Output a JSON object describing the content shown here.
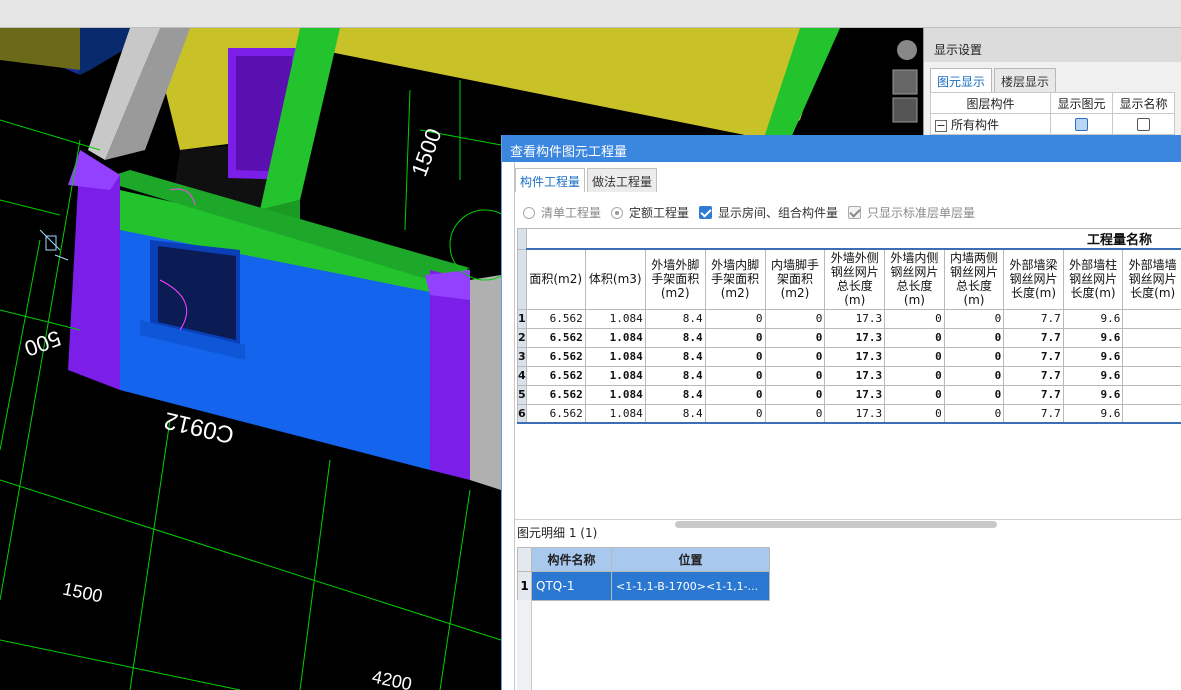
{
  "viewport": {
    "dimensions": {
      "d1500_top": "1500",
      "d500_left": "500",
      "d1500_bottom": "1500",
      "d4200": "4200",
      "d500_side": "500"
    },
    "window_label": "C0912",
    "colors": {
      "green": "#22c32c",
      "yellow": "#c8c228",
      "blue": "#1464ee",
      "purple": "#7b1ee8",
      "grid": "#00d000"
    }
  },
  "display_panel": {
    "title": "显示设置",
    "tabs": [
      "图元显示",
      "楼层显示"
    ],
    "columns": [
      "图层构件",
      "显示图元",
      "显示名称"
    ],
    "row_label": "所有构件"
  },
  "dialog": {
    "title": "查看构件图元工程量",
    "tabs": [
      "构件工程量",
      "做法工程量"
    ],
    "options": {
      "list_qty": "清单工程量",
      "quota_qty": "定额工程量",
      "show_rooms": "显示房间、组合构件量",
      "std_layer_only": "只显示标准层单层量"
    },
    "group_header": "工程量名称",
    "columns": [
      "面积(m2)",
      "体积(m3)",
      "外墙外脚手架面积(m2)",
      "外墙内脚手架面积(m2)",
      "内墙脚手架面积(m2)",
      "外墙外侧钢丝网片总长度(m)",
      "外墙内侧钢丝网片总长度(m)",
      "内墙两侧钢丝网片总长度(m)",
      "外部墙梁钢丝网片长度(m)",
      "外部墙柱钢丝网片长度(m)",
      "外部墙墙钢丝网片长度(m)"
    ],
    "rows": [
      {
        "n": "1",
        "bold": false,
        "v": [
          "6.562",
          "1.084",
          "8.4",
          "0",
          "0",
          "17.3",
          "0",
          "0",
          "7.7",
          "9.6",
          ""
        ]
      },
      {
        "n": "2",
        "bold": true,
        "v": [
          "6.562",
          "1.084",
          "8.4",
          "0",
          "0",
          "17.3",
          "0",
          "0",
          "7.7",
          "9.6",
          ""
        ]
      },
      {
        "n": "3",
        "bold": true,
        "v": [
          "6.562",
          "1.084",
          "8.4",
          "0",
          "0",
          "17.3",
          "0",
          "0",
          "7.7",
          "9.6",
          ""
        ]
      },
      {
        "n": "4",
        "bold": true,
        "v": [
          "6.562",
          "1.084",
          "8.4",
          "0",
          "0",
          "17.3",
          "0",
          "0",
          "7.7",
          "9.6",
          ""
        ]
      },
      {
        "n": "5",
        "bold": true,
        "v": [
          "6.562",
          "1.084",
          "8.4",
          "0",
          "0",
          "17.3",
          "0",
          "0",
          "7.7",
          "9.6",
          ""
        ]
      },
      {
        "n": "6",
        "bold": false,
        "v": [
          "6.562",
          "1.084",
          "8.4",
          "0",
          "0",
          "17.3",
          "0",
          "0",
          "7.7",
          "9.6",
          ""
        ]
      }
    ],
    "detail": {
      "label": "图元明细  1 (1)",
      "columns": [
        "构件名称",
        "位置"
      ],
      "row_num": "1",
      "name": "QTQ-1",
      "location": "<1-1,1-B-1700><1-1,1-..."
    }
  }
}
